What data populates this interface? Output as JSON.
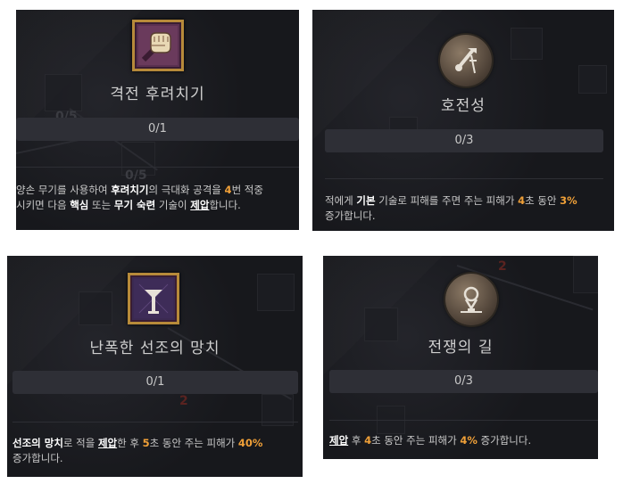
{
  "cards": [
    {
      "title": "격전 후려치기",
      "rank": "0/1",
      "desc": {
        "l1_p1": "양손 무기를 사용하여 ",
        "l1_b1": "후려치기",
        "l1_p2": "의 극대화 공격을 ",
        "l1_n1": "4",
        "l1_p3": "번 적중",
        "l2_p1": "시키면 다음 ",
        "l2_b1": "핵심",
        "l2_p2": " 또는 ",
        "l2_b2": "무기 숙련",
        "l2_p3": " 기술이 ",
        "l2_u1": "제압",
        "l2_p4": "합니다."
      },
      "ghost_numbers": [
        "0/5",
        "0/5"
      ]
    },
    {
      "title": "호전성",
      "rank": "0/3",
      "desc": {
        "l1_p1": "적에게 ",
        "l1_b1": "기본",
        "l1_p2": " 기술로 피해를 주면 주는 피해가 ",
        "l1_n1": "4",
        "l1_p3": "초 동안 ",
        "l1_n2": "3%",
        "l2_p1": "증가합니다."
      }
    },
    {
      "title": "난폭한 선조의 망치",
      "rank": "0/1",
      "desc": {
        "l1_b1": "선조의 망치",
        "l1_p1": "로 적을 ",
        "l1_u1": "제압",
        "l1_p2": "한 후 ",
        "l1_n1": "5",
        "l1_p3": "초 동안 주는 피해가 ",
        "l1_n2": "40%",
        "l2_p1": "증가합니다."
      },
      "ghost_numbers": [
        "2"
      ]
    },
    {
      "title": "전쟁의 길",
      "rank": "0/3",
      "desc": {
        "l1_u1": "제압",
        "l1_p1": " 후 ",
        "l1_n1": "4",
        "l1_p2": "초 동안 주는 피해가 ",
        "l1_n2": "4%",
        "l1_p3": " 증가합니다."
      },
      "ghost_numbers": [
        "2"
      ]
    }
  ],
  "icons": [
    "fist-icon",
    "hammer-rune-icon",
    "ancestral-hammer-icon",
    "war-path-icon"
  ],
  "colors": {
    "accent_number": "#f0a038",
    "panel_bg": "#17181c",
    "rank_bar": "#2e2f36",
    "frame_gold": "#b78a3a"
  }
}
